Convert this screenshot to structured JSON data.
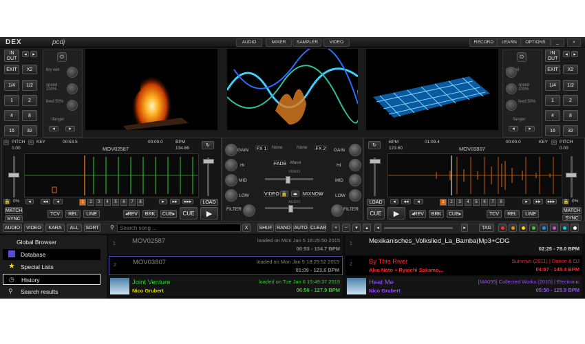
{
  "app": {
    "logo": "DEX",
    "logo2": "pcdj",
    "red_title": "",
    "top_tabs": [
      "AUDIO",
      "MIXER",
      "SAMPLER",
      "VIDEO"
    ],
    "right_tabs": [
      "RECORD",
      "LEARN",
      "OPTIONS"
    ],
    "window_btns": [
      "_",
      "×"
    ]
  },
  "deck_left": {
    "in_label": "IN OUT",
    "exit": "EXIT",
    "x2": "X2",
    "loops": [
      "1/4",
      "1/2",
      "1",
      "2",
      "4",
      "8",
      "16",
      "32"
    ],
    "fx_knobs": [
      "dry wet",
      "speed 100%",
      "feed 50%",
      "flanger"
    ],
    "pitch_label": "PITCH",
    "pitch_val": "0.00",
    "key_label": "KEY",
    "time_elapsed": "00:53.5",
    "time_remain": "00:00.0",
    "bpm_label": "BPM",
    "title": "MOV02587",
    "bpm": "134.66",
    "hotcues": [
      "1",
      "2",
      "3",
      "4",
      "5",
      "6",
      "7",
      "8"
    ],
    "match": "MATCH",
    "sync": "SYNC",
    "pct": "0%",
    "tcv": "TCV",
    "rel": "REL",
    "line": "LINE",
    "rev": "◂REV",
    "brk": "BRK",
    "cueb": "CUE▸",
    "cue": "CUE",
    "load": "LOAD"
  },
  "deck_right": {
    "in_label": "IN OUT",
    "exit": "EXIT",
    "x2": "X2",
    "loops": [
      "1/4",
      "1/2",
      "1",
      "2",
      "4",
      "8",
      "16",
      "32"
    ],
    "fx_knobs": [
      "dry wet",
      "speed 100%",
      "feed 50%",
      "flanger"
    ],
    "pitch_label": "PITCH",
    "pitch_val": "0.00",
    "key_label": "KEY",
    "time_elapsed": "01:09.4",
    "time_remain": "00:00.0",
    "bpm_label": "BPM",
    "title": "MOV03807",
    "bpm": "123.60",
    "hotcues": [
      "1",
      "2",
      "3",
      "4",
      "5",
      "6",
      "7",
      "8"
    ],
    "match": "MATCH",
    "sync": "SYNC",
    "pct": "0%",
    "tcv": "TCV",
    "rel": "REL",
    "line": "LINE",
    "rev": "◂REV",
    "brk": "BRK",
    "cueb": "CUE▸",
    "cue": "CUE",
    "load": "LOAD"
  },
  "mixer": {
    "gain": "GAIN",
    "hi": "HI",
    "mid": "MID",
    "low": "LOW",
    "filter": "FILTER",
    "fx1": "FX 1",
    "fx2": "FX 2",
    "none": "None",
    "fade": "FADE",
    "wave": "Wave",
    "video": "VIDEO",
    "audio": "AUDIO",
    "mixnow": "MIXNOW",
    "video_btn": "VIDEO"
  },
  "browser_bar": {
    "tabs": [
      "AUDIO",
      "VIDEO",
      "KARA",
      "ALL",
      "SORT"
    ],
    "search_placeholder": "Search song ...",
    "clear_x": "X",
    "shuf": "SHUF",
    "rand": "RAND",
    "auto": "AUTO",
    "clear": "CLEAR",
    "tag": "TAG"
  },
  "sidebar": [
    {
      "label": "Global Browser"
    },
    {
      "label": "Database"
    },
    {
      "label": "Special Lists"
    },
    {
      "label": "History"
    },
    {
      "label": "Search results"
    }
  ],
  "left_list": [
    {
      "num": "1",
      "name": "MOV02587",
      "loaded": "loaded on Mon Jan  5 18:25:50 2015",
      "time_bpm": "00:53 - 134.7 BPM"
    },
    {
      "num": "2",
      "name": "MOV03807",
      "loaded": "loaded on Mon Jan  5 18:25:52 2015",
      "time_bpm": "01:09 - 123.6 BPM"
    },
    {
      "num": "",
      "name": "Joint Venture",
      "artist": "Nico Grubert",
      "loaded": "loaded on Tue Jan  6 15:49:37 2015",
      "time_bpm": "06:56 - 127.9 BPM"
    }
  ],
  "right_list": [
    {
      "num": "1",
      "name": "Mexikanisches_Volkslied_La_Bamba(Mp3+CDG",
      "info": "",
      "time_bpm": "02:25 - 78.0 BPM"
    },
    {
      "num": "2",
      "name": "By This River",
      "artist": "Alva Noto + Ryuichi Sakamo...",
      "info": "Summvs (2011) | Dance & DJ",
      "time_bpm": "04:07 - 148.4 BPM"
    },
    {
      "num": "",
      "name": "Heat Me",
      "artist": "Nico Grubert",
      "info": "[MA055] Collected Works (2010) | Electronic",
      "time_bpm": "05:50 - 125.9 BPM"
    }
  ],
  "colors": {
    "orange": "#e06a10",
    "green": "#2ed32e",
    "red": "#ff2a2a",
    "purple": "#9b4cff",
    "yellow": "#d8d800"
  }
}
